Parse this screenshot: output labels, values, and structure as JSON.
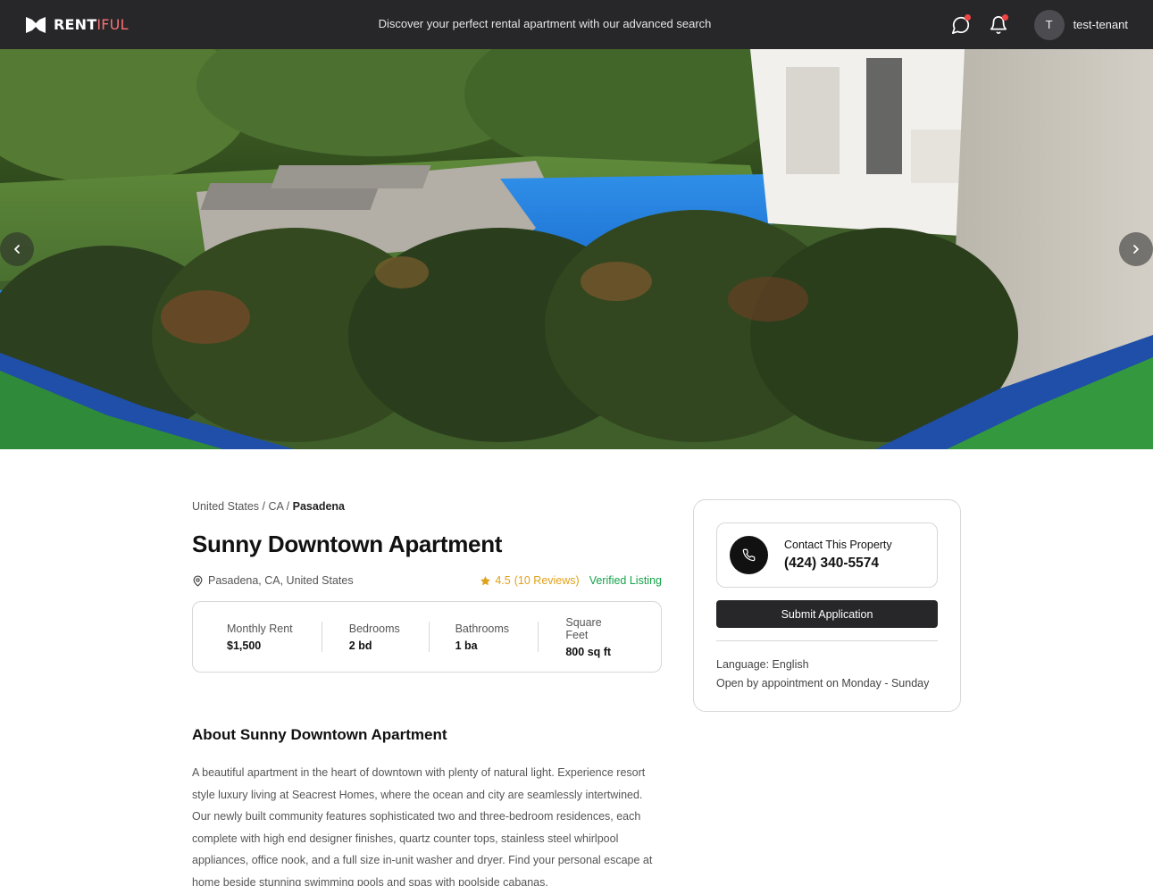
{
  "nav": {
    "brand_main": "RENT",
    "brand_accent": "IFUL",
    "tagline": "Discover your perfect rental apartment with our advanced search",
    "messages_icon": "chat-bubble-icon",
    "notifications_icon": "bell-icon",
    "avatar_initial": "T",
    "username": "test-tenant",
    "accent_color": "#f87171",
    "badge_color": "#ef4444"
  },
  "hero": {
    "prev_icon": "chevron-left-icon",
    "next_icon": "chevron-right-icon"
  },
  "listing": {
    "breadcrumb": {
      "country": "United States",
      "state": "CA",
      "city": "Pasadena",
      "separator": "/"
    },
    "title": "Sunny Downtown Apartment",
    "location": "Pasadena, CA, United States",
    "rating": "4.5",
    "reviews": "(10 Reviews)",
    "verified": "Verified Listing",
    "stats": [
      {
        "label": "Monthly Rent",
        "value": "$1,500"
      },
      {
        "label": "Bedrooms",
        "value": "2 bd"
      },
      {
        "label": "Bathrooms",
        "value": "1 ba"
      },
      {
        "label": "Square Feet",
        "value": "800 sq ft"
      }
    ],
    "about_title": "About Sunny Downtown Apartment",
    "about_text": "A beautiful apartment in the heart of downtown with plenty of natural light. Experience resort style luxury living at Seacrest Homes, where the ocean and city are seamlessly intertwined. Our newly built community features sophisticated two and three-bedroom residences, each complete with high end designer finishes, quartz counter tops, stainless steel whirlpool appliances, office nook, and a full size in-unit washer and dryer. Find your personal escape at home beside stunning swimming pools and spas with poolside cabanas."
  },
  "contact": {
    "label": "Contact This Property",
    "phone": "(424) 340-5574",
    "submit_label": "Submit Application",
    "language": "Language: English",
    "hours": "Open by appointment on Monday - Sunday"
  }
}
